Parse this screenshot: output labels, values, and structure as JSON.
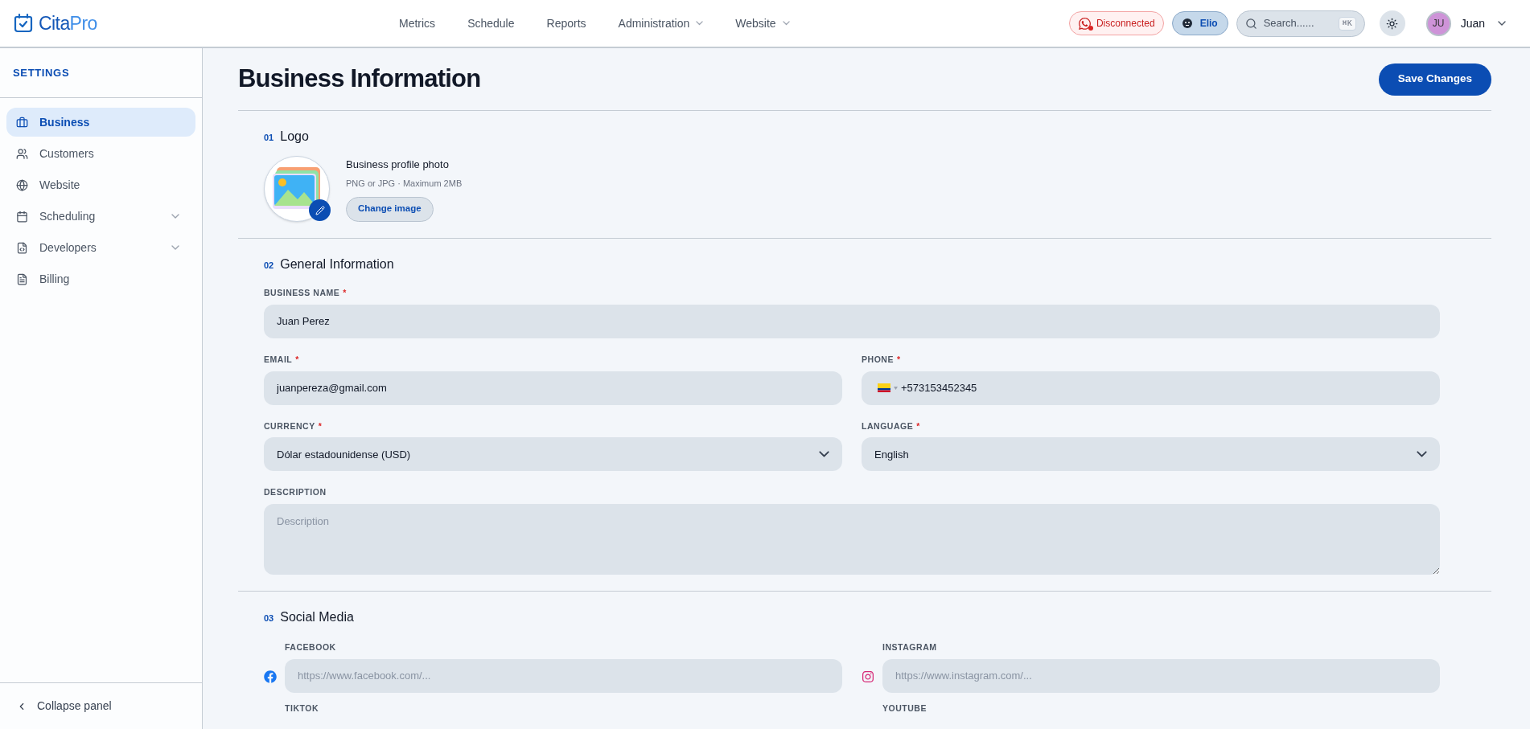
{
  "logo": {
    "name": "Cita",
    "suffix": "Pro"
  },
  "nav": [
    {
      "label": "Metrics",
      "dropdown": false
    },
    {
      "label": "Schedule",
      "dropdown": false
    },
    {
      "label": "Reports",
      "dropdown": false
    },
    {
      "label": "Administration",
      "dropdown": true
    },
    {
      "label": "Website",
      "dropdown": true
    }
  ],
  "connection": {
    "label": "Disconnected",
    "connected": false
  },
  "assistant": {
    "label": "Elio"
  },
  "search": {
    "placeholder": "Search......",
    "shortcut": "⌘K"
  },
  "user": {
    "initials": "JU",
    "name": "Juan"
  },
  "sidebar": {
    "title": "SETTINGS",
    "items": [
      {
        "label": "Business",
        "selected": true,
        "expandable": false
      },
      {
        "label": "Customers",
        "selected": false,
        "expandable": false
      },
      {
        "label": "Website",
        "selected": false,
        "expandable": false
      },
      {
        "label": "Scheduling",
        "selected": false,
        "expandable": true
      },
      {
        "label": "Developers",
        "selected": false,
        "expandable": true
      },
      {
        "label": "Billing",
        "selected": false,
        "expandable": false
      }
    ],
    "collapse": "Collapse panel"
  },
  "page": {
    "title": "Business Information",
    "save": "Save Changes"
  },
  "logo_section": {
    "number": "01",
    "title": "Logo",
    "heading": "Business profile photo",
    "hint": "PNG or JPG · Maximum 2MB",
    "button": "Change image"
  },
  "general_section": {
    "number": "02",
    "title": "General Information",
    "fields": [
      {
        "kind": "text",
        "label": "BUSINESS NAME",
        "required_mark": "*",
        "value": "Juan Perez",
        "wide": true
      },
      {
        "kind": "text",
        "label": "EMAIL",
        "required_mark": "*",
        "value": "juanpereza@gmail.com",
        "wide": false
      },
      {
        "kind": "phone",
        "label": "PHONE",
        "required_mark": "*",
        "value": "+573153452345",
        "wide": false
      },
      {
        "kind": "select",
        "label": "CURRENCY",
        "required_mark": "*",
        "value": "Dólar estadounidense (USD)",
        "wide": false
      },
      {
        "kind": "select",
        "label": "LANGUAGE",
        "required_mark": "*",
        "value": "English",
        "wide": false
      },
      {
        "kind": "textarea",
        "label": "DESCRIPTION",
        "placeholder": "Description",
        "wide": true
      }
    ]
  },
  "social_section": {
    "number": "03",
    "title": "Social Media",
    "fields": [
      {
        "kind": "facebook",
        "label": "FACEBOOK",
        "placeholder": "https://www.facebook.com/..."
      },
      {
        "kind": "instagram",
        "label": "INSTAGRAM",
        "placeholder": "https://www.instagram.com/..."
      },
      {
        "label": "TIKTOK"
      },
      {
        "label": "YOUTUBE"
      }
    ]
  }
}
